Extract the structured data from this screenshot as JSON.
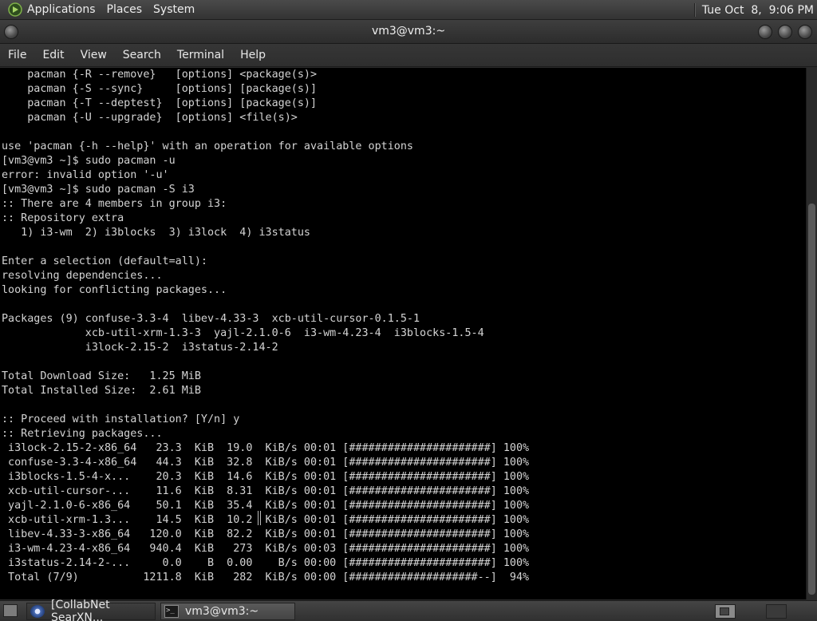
{
  "top_panel": {
    "menus": [
      "Applications",
      "Places",
      "System"
    ],
    "clock": "Tue Oct  8,  9:06 PM"
  },
  "window": {
    "title": "vm3@vm3:~"
  },
  "menubar": {
    "items": [
      "File",
      "Edit",
      "View",
      "Search",
      "Terminal",
      "Help"
    ]
  },
  "terminal": {
    "lines": [
      "    pacman {-R --remove}   [options] <package(s)>",
      "    pacman {-S --sync}     [options] [package(s)]",
      "    pacman {-T --deptest}  [options] [package(s)]",
      "    pacman {-U --upgrade}  [options] <file(s)>",
      "",
      "use 'pacman {-h --help}' with an operation for available options",
      "[vm3@vm3 ~]$ sudo pacman -u",
      "error: invalid option '-u'",
      "[vm3@vm3 ~]$ sudo pacman -S i3",
      ":: There are 4 members in group i3:",
      ":: Repository extra",
      "   1) i3-wm  2) i3blocks  3) i3lock  4) i3status",
      "",
      "Enter a selection (default=all):",
      "resolving dependencies...",
      "looking for conflicting packages...",
      "",
      "Packages (9) confuse-3.3-4  libev-4.33-3  xcb-util-cursor-0.1.5-1",
      "             xcb-util-xrm-1.3-3  yajl-2.1.0-6  i3-wm-4.23-4  i3blocks-1.5-4",
      "             i3lock-2.15-2  i3status-2.14-2",
      "",
      "Total Download Size:   1.25 MiB",
      "Total Installed Size:  2.61 MiB",
      "",
      ":: Proceed with installation? [Y/n] y",
      ":: Retrieving packages...",
      " i3lock-2.15-2-x86_64   23.3  KiB  19.0  KiB/s 00:01 [######################] 100%",
      " confuse-3.3-4-x86_64   44.3  KiB  32.8  KiB/s 00:01 [######################] 100%",
      " i3blocks-1.5-4-x...    20.3  KiB  14.6  KiB/s 00:01 [######################] 100%",
      " xcb-util-cursor-...    11.6  KiB  8.31  KiB/s 00:01 [######################] 100%",
      " yajl-2.1.0-6-x86_64    50.1  KiB  35.4  KiB/s 00:01 [######################] 100%",
      " xcb-util-xrm-1.3...    14.5  KiB  10.2  KiB/s 00:01 [######################] 100%",
      " libev-4.33-3-x86_64   120.0  KiB  82.2  KiB/s 00:01 [######################] 100%",
      " i3-wm-4.23-4-x86_64   940.4  KiB   273  KiB/s 00:03 [######################] 100%",
      " i3status-2.14-2-...     0.0    B  0.00    B/s 00:00 [######################] 100%",
      " Total (7/9)          1211.8  KiB   282  KiB/s 00:00 [####################--]  94%"
    ]
  },
  "taskbar": {
    "tasks": [
      {
        "label": "[CollabNet SearXN...",
        "icon": "browser-icon"
      },
      {
        "label": "vm3@vm3:~",
        "icon": "terminal-icon"
      }
    ]
  },
  "icons": {
    "term_glyph": ">_"
  }
}
